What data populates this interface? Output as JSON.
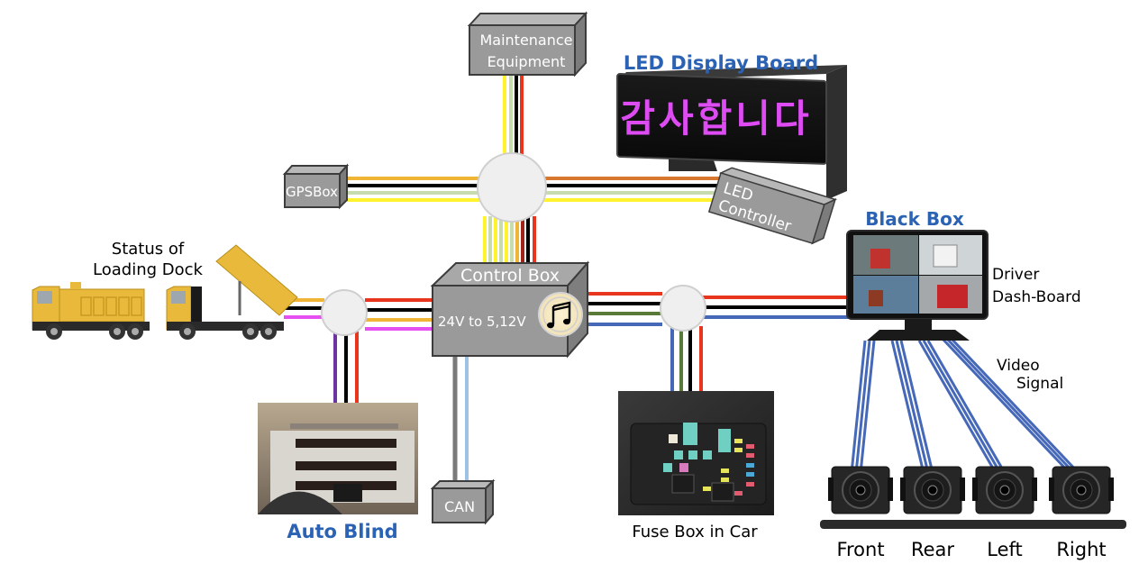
{
  "colors": {
    "yellow": "#FFF22E",
    "lightgreen": "#C6DBAE",
    "black": "#000000",
    "red": "#E8351E",
    "orange": "#F0B535",
    "darkorange": "#D8772E",
    "darkred": "#A02416",
    "magenta": "#E650F0",
    "purple": "#6A35A0",
    "green": "#597A36",
    "blue": "#4668B8",
    "gray": "#7A7A7A",
    "lightblue": "#9EC2E6",
    "box_fill": "#9A9A9A",
    "box_stroke": "#3C3C3C",
    "hub_fill": "#EFEFEF",
    "hub_stroke": "#CFCFCF",
    "title_blue": "#2B62B4"
  },
  "nodes": {
    "maintenance": {
      "label_line1": "Maintenance",
      "label_line2": "Equipment"
    },
    "gpsbox": {
      "label": "GPSBox"
    },
    "control_box": {
      "title": "Control Box",
      "subtitle": "24V to 5,12V",
      "icon": "music-note-icon"
    },
    "can": {
      "label": "CAN"
    },
    "led_controller": {
      "label_line1": "LED",
      "label_line2": "Controller"
    },
    "led_display": {
      "title": "LED Display Board",
      "text": "감사합니다"
    },
    "black_box": {
      "title": "Black Box",
      "label_line1": "Driver",
      "label_line2": "Dash-Board"
    },
    "video_signal": {
      "line1": "Video",
      "line2": "Signal"
    },
    "loading_dock": {
      "line1": "Status of",
      "line2": "Loading Dock"
    },
    "auto_blind": {
      "title": "Auto Blind"
    },
    "fuse_box": {
      "label": "Fuse Box in Car"
    },
    "cameras": [
      {
        "label": "Front"
      },
      {
        "label": "Rear"
      },
      {
        "label": "Left"
      },
      {
        "label": "Right"
      }
    ]
  }
}
